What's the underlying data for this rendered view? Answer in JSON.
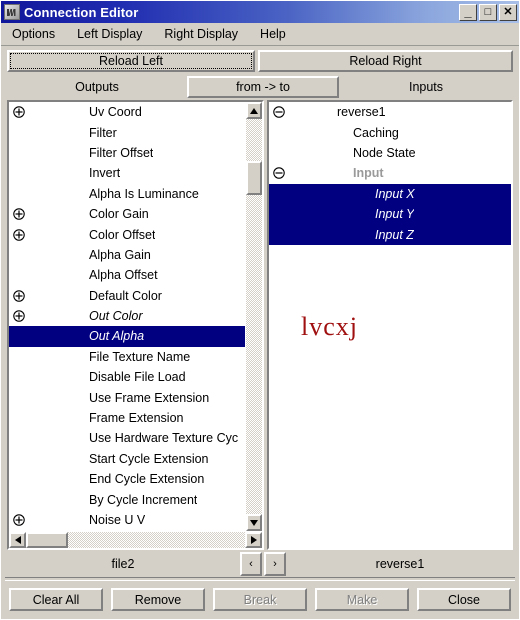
{
  "window": {
    "title": "Connection Editor",
    "icon": "maya-m-icon",
    "controls": {
      "minimize": "_",
      "maximize": "□",
      "close": "✕"
    }
  },
  "menubar": {
    "items": [
      {
        "label": "Options"
      },
      {
        "label": "Left Display"
      },
      {
        "label": "Right Display"
      },
      {
        "label": "Help"
      }
    ]
  },
  "toolbar": {
    "reload_left": "Reload Left",
    "reload_right": "Reload Right"
  },
  "tabs": {
    "outputs": "Outputs",
    "from_to": "from -> to",
    "inputs": "Inputs"
  },
  "left_pane": {
    "node_name": "file2",
    "rows": [
      {
        "label": "Uv Coord",
        "toggle": "plus",
        "level": 1,
        "italic": false,
        "selected": false,
        "grey": false
      },
      {
        "label": "Filter",
        "toggle": "none",
        "level": 1,
        "italic": false,
        "selected": false,
        "grey": false
      },
      {
        "label": "Filter Offset",
        "toggle": "none",
        "level": 1,
        "italic": false,
        "selected": false,
        "grey": false
      },
      {
        "label": "Invert",
        "toggle": "none",
        "level": 1,
        "italic": false,
        "selected": false,
        "grey": false
      },
      {
        "label": "Alpha Is Luminance",
        "toggle": "none",
        "level": 1,
        "italic": false,
        "selected": false,
        "grey": false
      },
      {
        "label": "Color Gain",
        "toggle": "plus",
        "level": 1,
        "italic": false,
        "selected": false,
        "grey": false
      },
      {
        "label": "Color Offset",
        "toggle": "plus",
        "level": 1,
        "italic": false,
        "selected": false,
        "grey": false
      },
      {
        "label": "Alpha Gain",
        "toggle": "none",
        "level": 1,
        "italic": false,
        "selected": false,
        "grey": false
      },
      {
        "label": "Alpha Offset",
        "toggle": "none",
        "level": 1,
        "italic": false,
        "selected": false,
        "grey": false
      },
      {
        "label": "Default Color",
        "toggle": "plus",
        "level": 1,
        "italic": false,
        "selected": false,
        "grey": false
      },
      {
        "label": "Out Color",
        "toggle": "plus",
        "level": 1,
        "italic": true,
        "selected": false,
        "grey": false
      },
      {
        "label": "Out Alpha",
        "toggle": "none",
        "level": 1,
        "italic": true,
        "selected": true,
        "grey": false
      },
      {
        "label": "File Texture Name",
        "toggle": "none",
        "level": 1,
        "italic": false,
        "selected": false,
        "grey": false
      },
      {
        "label": "Disable File Load",
        "toggle": "none",
        "level": 1,
        "italic": false,
        "selected": false,
        "grey": false
      },
      {
        "label": "Use Frame Extension",
        "toggle": "none",
        "level": 1,
        "italic": false,
        "selected": false,
        "grey": false
      },
      {
        "label": "Frame Extension",
        "toggle": "none",
        "level": 1,
        "italic": false,
        "selected": false,
        "grey": false
      },
      {
        "label": "Use Hardware Texture Cyc",
        "toggle": "none",
        "level": 1,
        "italic": false,
        "selected": false,
        "grey": false
      },
      {
        "label": "Start Cycle Extension",
        "toggle": "none",
        "level": 1,
        "italic": false,
        "selected": false,
        "grey": false
      },
      {
        "label": "End Cycle Extension",
        "toggle": "none",
        "level": 1,
        "italic": false,
        "selected": false,
        "grey": false
      },
      {
        "label": "By Cycle Increment",
        "toggle": "none",
        "level": 1,
        "italic": false,
        "selected": false,
        "grey": false
      },
      {
        "label": "Noise U V",
        "toggle": "plus",
        "level": 1,
        "italic": false,
        "selected": false,
        "grey": false
      }
    ]
  },
  "right_pane": {
    "node_name": "reverse1",
    "annotation": "lvcxj",
    "annotation_color": "#a01010",
    "rows": [
      {
        "label": "reverse1",
        "toggle": "minus",
        "level": 1,
        "italic": false,
        "selected": false,
        "grey": false
      },
      {
        "label": "Caching",
        "toggle": "none",
        "level": 2,
        "italic": false,
        "selected": false,
        "grey": false
      },
      {
        "label": "Node State",
        "toggle": "none",
        "level": 2,
        "italic": false,
        "selected": false,
        "grey": false
      },
      {
        "label": "Input",
        "toggle": "minus",
        "level": 2,
        "italic": false,
        "selected": false,
        "grey": true
      },
      {
        "label": "Input X",
        "toggle": "none",
        "level": 3,
        "italic": true,
        "selected": true,
        "grey": false
      },
      {
        "label": "Input Y",
        "toggle": "none",
        "level": 3,
        "italic": true,
        "selected": true,
        "grey": false
      },
      {
        "label": "Input Z",
        "toggle": "none",
        "level": 3,
        "italic": true,
        "selected": true,
        "grey": false
      }
    ]
  },
  "nav": {
    "prev": "‹",
    "next": "›"
  },
  "footer": {
    "buttons": [
      {
        "label": "Clear All",
        "disabled": false
      },
      {
        "label": "Remove",
        "disabled": false
      },
      {
        "label": "Break",
        "disabled": true
      },
      {
        "label": "Make",
        "disabled": true
      },
      {
        "label": "Close",
        "disabled": false
      }
    ]
  },
  "colors": {
    "selection": "#000080",
    "face": "#d4d0c8",
    "title_start": "#11179a",
    "title_end": "#a8bfe8"
  }
}
